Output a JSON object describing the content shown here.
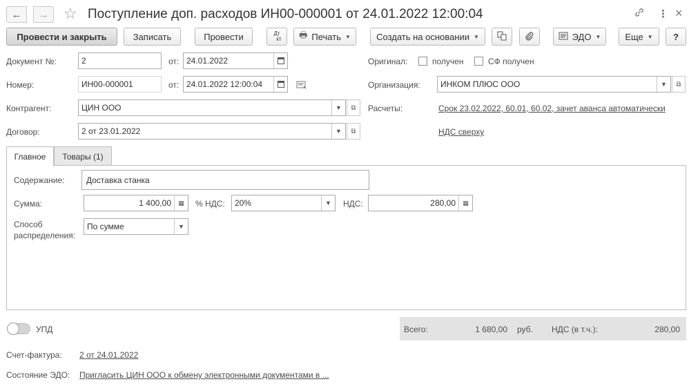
{
  "header": {
    "title": "Поступление доп. расходов ИН00-000001 от 24.01.2022 12:00:04",
    "back_icon": "←",
    "forward_icon": "→",
    "star_icon": "☆",
    "link_icon": "🔗",
    "more_icon": "⋮",
    "close_icon": "×"
  },
  "toolbar": {
    "post_close": "Провести и закрыть",
    "save": "Записать",
    "post": "Провести",
    "dtkt_top": "Дт",
    "dtkt_bottom": "кт",
    "print": "Печать",
    "create_based": "Создать на основании",
    "edo": "ЭДО",
    "more": "Еще",
    "help": "?"
  },
  "form": {
    "doc_number_label": "Документ №:",
    "doc_number_value": "2",
    "from_label": "от:",
    "doc_date": "24.01.2022",
    "number_label": "Номер:",
    "number_value": "ИН00-000001",
    "from_label2": "от:",
    "number_datetime": "24.01.2022 12:00:04",
    "counterparty_label": "Контрагент:",
    "counterparty_value": "ЦИН ООО",
    "contract_label": "Договор:",
    "contract_value": "2 от 23.01.2022",
    "original_label": "Оригинал:",
    "received_label": "получен",
    "sf_received_label": "СФ получен",
    "organization_label": "Организация:",
    "organization_value": "ИНКОМ ПЛЮС ООО",
    "settlements_label": "Расчеты:",
    "settlements_link": "Срок 23.02.2022, 60.01, 60.02, зачет аванса автоматически",
    "vat_link": "НДС сверху"
  },
  "tabs": [
    {
      "label": "Главное"
    },
    {
      "label": "Товары (1)"
    }
  ],
  "main": {
    "content_label": "Содержание:",
    "content_value": "Доставка станка",
    "sum_label": "Сумма:",
    "sum_value": "1 400,00",
    "vat_pct_label": "% НДС:",
    "vat_pct_value": "20%",
    "vat_label": "НДС:",
    "vat_value": "280,00",
    "distribution_label_1": "Способ",
    "distribution_label_2": "распределения:",
    "distribution_value": "По сумме"
  },
  "footer": {
    "upd_label": "УПД",
    "total_label": "Всего:",
    "total_value": "1 680,00",
    "currency": "руб.",
    "vat_incl_label": "НДС (в т.ч.):",
    "vat_incl_value": "280,00",
    "invoice_label": "Счет-фактура:",
    "invoice_link": "2 от 24.01.2022",
    "edo_state_label": "Состояние ЭДО:",
    "edo_state_link": "Пригласить ЦИН ООО к обмену электронными документами в ..."
  }
}
